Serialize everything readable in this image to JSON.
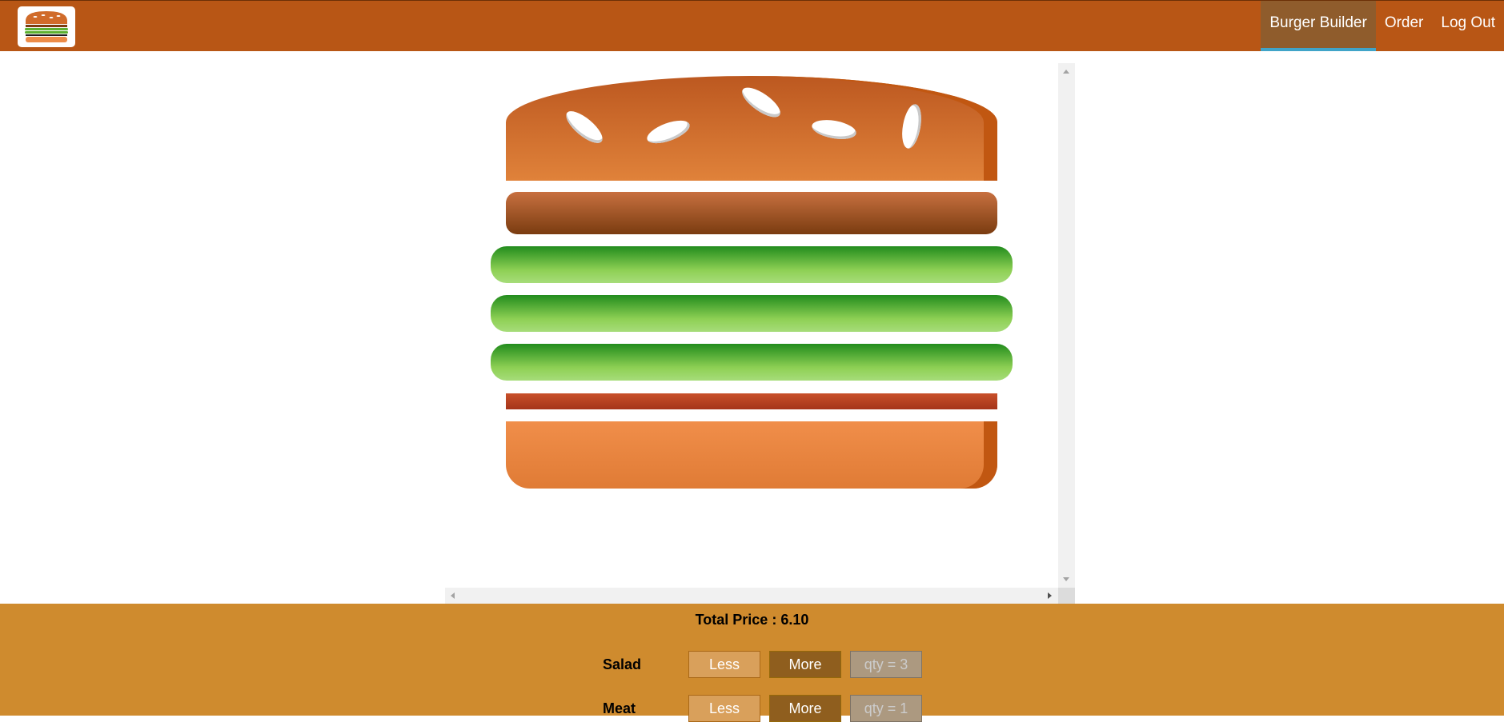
{
  "nav": {
    "items": [
      {
        "label": "Burger Builder",
        "active": true
      },
      {
        "label": "Order",
        "active": false
      },
      {
        "label": "Log Out",
        "active": false
      }
    ]
  },
  "burger": {
    "layers": [
      "bread-top",
      "meat",
      "salad",
      "salad",
      "salad",
      "bacon",
      "bread-bottom"
    ]
  },
  "controls": {
    "total_price": "Total Price : 6.10",
    "rows": [
      {
        "label": "Salad",
        "less": "Less",
        "more": "More",
        "qty": "qty = 3"
      },
      {
        "label": "Meat",
        "less": "Less",
        "more": "More",
        "qty": "qty = 1"
      }
    ]
  },
  "colors": {
    "toolbar": "#b85615",
    "nav_active": "#8f5c2c",
    "nav_active_indicator": "#40a4c8",
    "controls_bg": "#cf8b2e",
    "more_button": "#8f5e1e",
    "less_button": "#d9a05b"
  }
}
